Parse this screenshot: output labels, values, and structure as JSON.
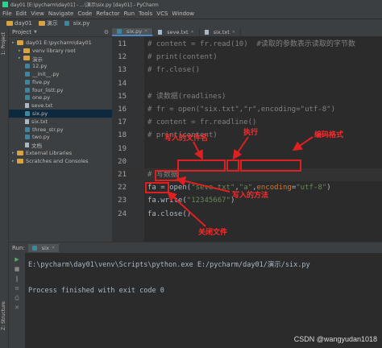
{
  "window": {
    "title": "day01 [E:\\pycharm\\day01] - ...\\演示\\six.py [day01] - PyCharm"
  },
  "menu": [
    "File",
    "Edit",
    "View",
    "Navigate",
    "Code",
    "Refactor",
    "Run",
    "Tools",
    "VCS",
    "Window"
  ],
  "navbar": {
    "crumbs": [
      "day01",
      "演示",
      "six.py"
    ]
  },
  "left_strip": {
    "project_tab": "1: Project",
    "structure_tab": "Z: Structure"
  },
  "project_panel": {
    "title": "Project",
    "tree": [
      {
        "label": "day01  E:\\pycharm\\day01",
        "kind": "folder",
        "indent": 1
      },
      {
        "label": "venv  library root",
        "kind": "folder",
        "indent": 2
      },
      {
        "label": "演示",
        "kind": "folder",
        "indent": 2
      },
      {
        "label": "12.py",
        "kind": "py",
        "indent": 3
      },
      {
        "label": "__init__.py",
        "kind": "py",
        "indent": 3
      },
      {
        "label": "five.py",
        "kind": "py",
        "indent": 3
      },
      {
        "label": "four_listt.py",
        "kind": "py",
        "indent": 3
      },
      {
        "label": "one.py",
        "kind": "py",
        "indent": 3
      },
      {
        "label": "seve.txt",
        "kind": "txt",
        "indent": 3
      },
      {
        "label": "six.py",
        "kind": "py",
        "indent": 3,
        "selected": true
      },
      {
        "label": "six.txt",
        "kind": "txt",
        "indent": 3
      },
      {
        "label": "three_str.py",
        "kind": "py",
        "indent": 3
      },
      {
        "label": "two.py",
        "kind": "py",
        "indent": 3
      },
      {
        "label": "文档",
        "kind": "txt",
        "indent": 3
      },
      {
        "label": "External Libraries",
        "kind": "folder",
        "indent": 1
      },
      {
        "label": "Scratches and Consoles",
        "kind": "folder",
        "indent": 1
      }
    ]
  },
  "editor": {
    "tabs": [
      {
        "label": "six.py",
        "active": true
      },
      {
        "label": "seve.txt",
        "active": false
      },
      {
        "label": "six.txt",
        "active": false
      }
    ],
    "lines": [
      {
        "n": "11",
        "parts": [
          [
            "cm",
            "# content = fr.read(10)  #读取的参数表示读取的字节数"
          ]
        ]
      },
      {
        "n": "12",
        "parts": [
          [
            "cm",
            "# print(content)"
          ]
        ]
      },
      {
        "n": "13",
        "parts": [
          [
            "cm",
            "# fr.close()"
          ]
        ]
      },
      {
        "n": "14",
        "parts": []
      },
      {
        "n": "15",
        "parts": [
          [
            "cm",
            "# 读数据(readlines)"
          ]
        ]
      },
      {
        "n": "16",
        "parts": [
          [
            "cm",
            "# fr = open(\"six.txt\",\"r\",encoding=\"utf-8\")"
          ]
        ]
      },
      {
        "n": "17",
        "parts": [
          [
            "cm",
            "# content = fr.readline()"
          ]
        ]
      },
      {
        "n": "18",
        "parts": [
          [
            "cm",
            "# print(content)"
          ]
        ]
      },
      {
        "n": "19",
        "parts": []
      },
      {
        "n": "20",
        "parts": []
      },
      {
        "n": "21",
        "parts": [
          [
            "cm",
            "# 写数据"
          ]
        ]
      },
      {
        "n": "22",
        "parts": [
          [
            "plain",
            "fa = open("
          ],
          [
            "str",
            "\"seve.txt\""
          ],
          [
            "plain",
            ","
          ],
          [
            "str",
            "\"a\""
          ],
          [
            "plain",
            ","
          ],
          [
            "kw",
            "encoding"
          ],
          [
            "plain",
            "="
          ],
          [
            "str",
            "\"utf-8\""
          ],
          [
            "plain",
            ")"
          ]
        ]
      },
      {
        "n": "23",
        "parts": [
          [
            "plain",
            "fa.write("
          ],
          [
            "str",
            "\"12345667\""
          ],
          [
            "plain",
            ")"
          ]
        ]
      },
      {
        "n": "24",
        "parts": [
          [
            "plain",
            "fa.close()"
          ]
        ]
      }
    ]
  },
  "annotations": {
    "filename": "写入的文件名",
    "execute": "执行",
    "encoding": "编码格式",
    "write_method": "写入的方法",
    "close_file": "关闭文件"
  },
  "run_panel": {
    "label": "Run:",
    "tab": "six",
    "console": [
      "E:\\pycharm\\day01\\venv\\Scripts\\python.exe E:/pycharm/day01/演示/six.py",
      "",
      "Process finished with exit code 0"
    ]
  },
  "watermark": "CSDN @wangyudan1018",
  "colors": {
    "annotation": "#e02020",
    "comment": "#808080",
    "string": "#6a8759",
    "keyword": "#cc7832"
  }
}
